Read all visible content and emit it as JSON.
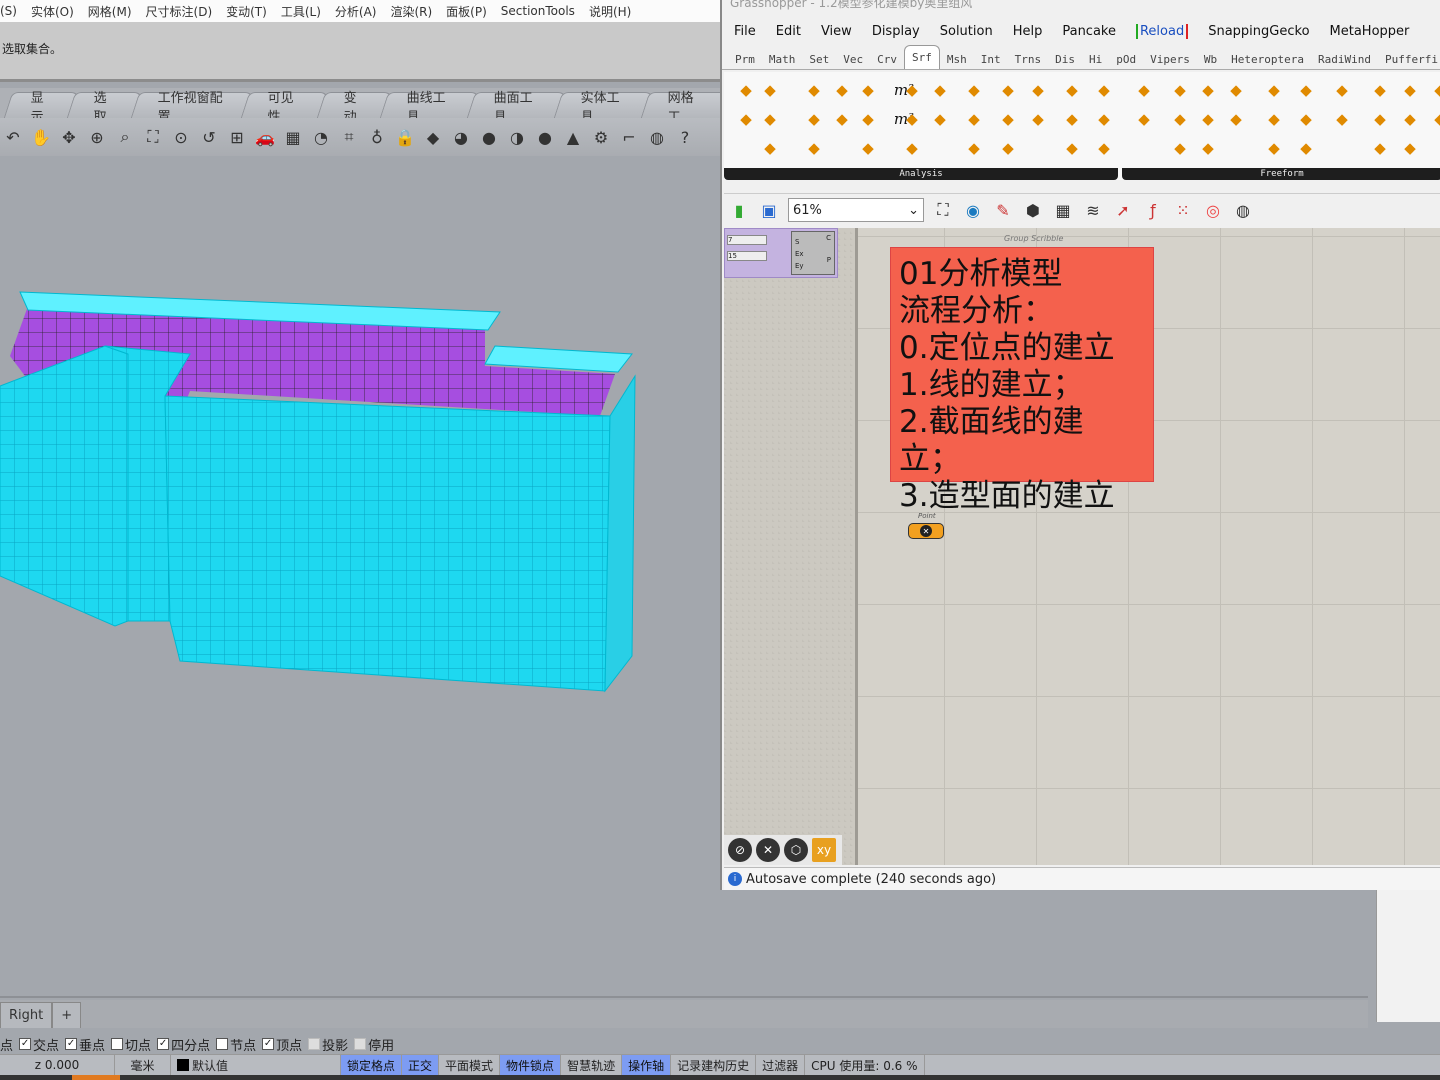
{
  "rhino": {
    "menu": [
      "(S)",
      "实体(O)",
      "网格(M)",
      "尺寸标注(D)",
      "变动(T)",
      "工具(L)",
      "分析(A)",
      "渲染(R)",
      "面板(P)",
      "SectionTools",
      "说明(H)"
    ],
    "command_lines": [
      "选取集合。"
    ],
    "tabs": [
      "显示",
      "选取",
      "工作视窗配置",
      "可见性",
      "变动",
      "曲线工具",
      "曲面工具",
      "实体工具",
      "网格工"
    ],
    "toolbar_icons": [
      "rotate-view-icon",
      "pan-hand-icon",
      "orbit-icon",
      "zoom-icon",
      "zoom-window-icon",
      "zoom-extents-icon",
      "zoom-selected-icon",
      "undo-view-icon",
      "four-viewports-icon",
      "car-icon",
      "grid-icon",
      "circle-icon",
      "object-snap-icon",
      "light-bulb-icon",
      "lock-icon",
      "layer-icon",
      "color-wheel-icon",
      "shaded-sphere-icon",
      "rendered-sphere-icon",
      "blue-sphere-icon",
      "cone-icon",
      "gear-icon",
      "dimension-icon",
      "globe-icon",
      "help-icon"
    ],
    "viewport_tab": "Right",
    "viewport_add": "+",
    "osnaps": [
      {
        "label": "点",
        "checked": null
      },
      {
        "label": "交点",
        "checked": true
      },
      {
        "label": "垂点",
        "checked": true
      },
      {
        "label": "切点",
        "checked": false
      },
      {
        "label": "四分点",
        "checked": true
      },
      {
        "label": "节点",
        "checked": false
      },
      {
        "label": "顶点",
        "checked": true
      },
      {
        "label": "投影",
        "checked": false
      },
      {
        "label": "停用",
        "checked": false
      }
    ],
    "status": {
      "z": "z 0.000",
      "unit": "毫米",
      "layer": "默认值",
      "toggles": [
        {
          "label": "锁定格点",
          "on": true
        },
        {
          "label": "正交",
          "on": true
        },
        {
          "label": "平面模式",
          "on": false
        },
        {
          "label": "物件锁点",
          "on": true
        },
        {
          "label": "智慧轨迹",
          "on": false
        },
        {
          "label": "操作轴",
          "on": true
        },
        {
          "label": "记录建构历史",
          "on": false
        },
        {
          "label": "过滤器",
          "on": false
        }
      ],
      "cpu": "CPU 使用量: 0.6 %"
    },
    "model_color": "#00e5ff",
    "inner_color": "#a64ee0"
  },
  "gh": {
    "title": "Grasshopper - 1.2模型参化建模by奥里组风",
    "menu": [
      "File",
      "Edit",
      "View",
      "Display",
      "Solution",
      "Help",
      "Pancake",
      "Reload",
      "SnappingGecko",
      "MetaHopper"
    ],
    "tabs": [
      "Prm",
      "Math",
      "Set",
      "Vec",
      "Crv",
      "Srf",
      "Msh",
      "Int",
      "Trns",
      "Dis",
      "Hi",
      "pOd",
      "Vipers",
      "Wb",
      "Heteroptera",
      "RadiWind",
      "Pufferfi"
    ],
    "selected_tab": "Srf",
    "ribbon_groups": [
      "Analysis",
      "Freeform"
    ],
    "ribbon_text_icons": [
      "m²",
      "m³"
    ],
    "zoom": "61%",
    "panel_lines": [
      "01分析模型",
      "流程分析：",
      "0.定位点的建立",
      "1.线的建立；",
      "2.截面线的建立；",
      "3.造型面的建立"
    ],
    "panel_color": "#f4614d",
    "group_label": "Group Scribble",
    "point_label": "Point",
    "sliders": [
      "7",
      "15"
    ],
    "component_inputs": [
      "S",
      "Ex",
      "Ey"
    ],
    "component_outputs": [
      "C",
      "P"
    ],
    "status": "Autosave complete (240 seconds ago)"
  }
}
